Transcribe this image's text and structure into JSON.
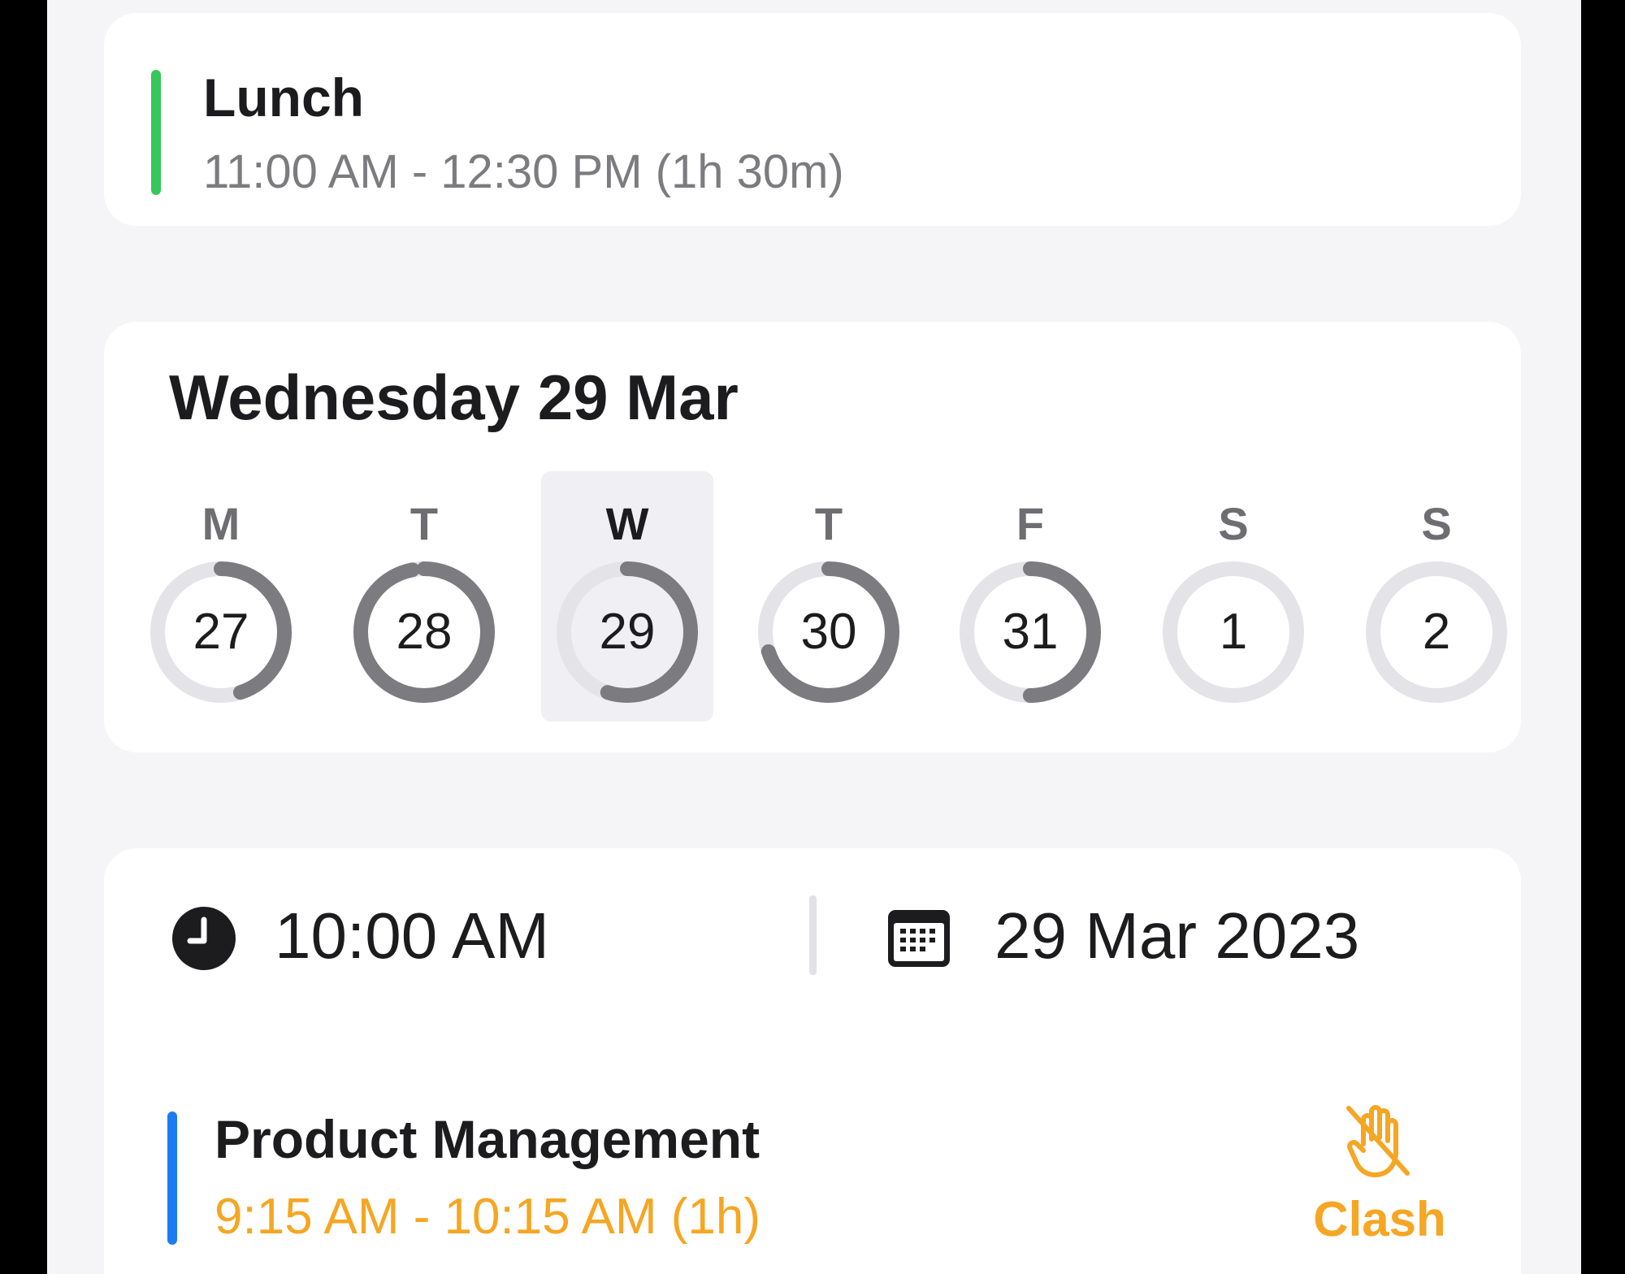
{
  "lunch_event": {
    "title": "Lunch",
    "time": "11:00 AM - 12:30 PM (1h 30m)",
    "accent_color": "#34c759"
  },
  "week": {
    "heading": "Wednesday 29 Mar",
    "selected_day": 29,
    "days": [
      {
        "letter": "M",
        "number": "27",
        "booked_fraction": 0.45,
        "selected": false
      },
      {
        "letter": "T",
        "number": "28",
        "booked_fraction": 0.97,
        "selected": false
      },
      {
        "letter": "W",
        "number": "29",
        "booked_fraction": 0.55,
        "selected": true
      },
      {
        "letter": "T",
        "number": "30",
        "booked_fraction": 0.7,
        "selected": false
      },
      {
        "letter": "F",
        "number": "31",
        "booked_fraction": 0.5,
        "selected": false
      },
      {
        "letter": "S",
        "number": "1",
        "booked_fraction": 0,
        "selected": false
      },
      {
        "letter": "S",
        "number": "2",
        "booked_fraction": 0,
        "selected": false
      }
    ],
    "ring_track_color": "#e3e3e8",
    "ring_fill_color": "#7c7c80"
  },
  "new_event": {
    "time_icon": "clock-icon",
    "time": "10:00 AM",
    "date_icon": "calendar-icon",
    "date": "29 Mar 2023"
  },
  "conflict_event": {
    "title": "Product Management",
    "time": "9:15 AM - 10:15 AM (1h)",
    "accent_color": "#1e7cf2",
    "time_color": "#f5a623",
    "badge_icon": "raised-hand-slash-icon",
    "badge_label": "Clash"
  }
}
